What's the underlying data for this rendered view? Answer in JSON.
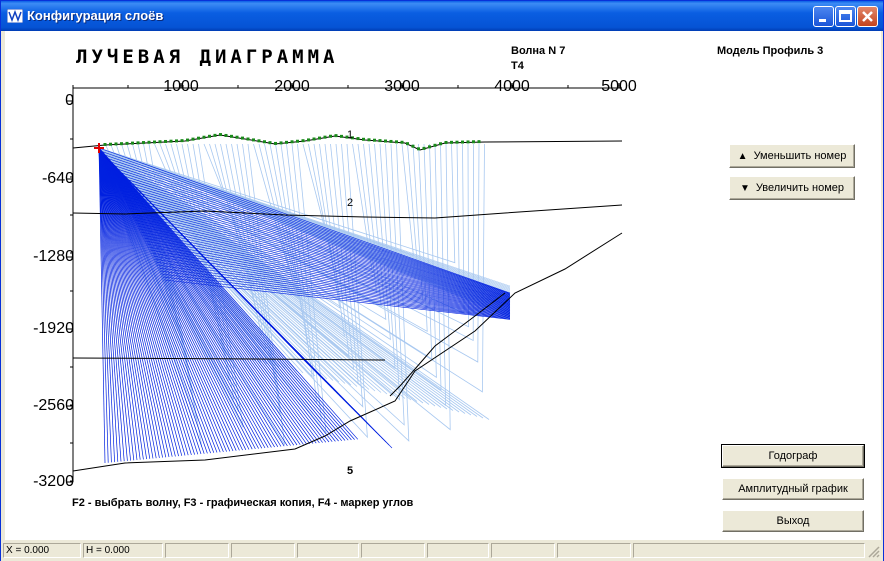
{
  "window": {
    "title": "Конфигурация слоёв",
    "colors": {
      "titlebar": "#0a5ee2",
      "bg": "#ece9d8"
    }
  },
  "plot": {
    "title": "ЛУЧЕВАЯ ДИАГРАММА",
    "wave_label": "Волна N 7",
    "wave_type": "T4",
    "model_label": "Модель Профиль 3",
    "x_ticks": [
      "1000",
      "2000",
      "3000",
      "4000",
      "5000"
    ],
    "y_ticks": [
      "0",
      "-640",
      "-1280",
      "-1920",
      "-2560",
      "-3200"
    ],
    "layer_labels": [
      "1",
      "2",
      "5"
    ],
    "hint": "F2 - выбрать волну, F3 - графическая копия, F4 - маркер углов",
    "colors": {
      "rays_dark": "#0020e0",
      "rays_light": "#a8c8f0",
      "receivers": "#1a8a1a",
      "source": "#e00000"
    }
  },
  "buttons": {
    "decrease": "Уменьшить номер",
    "increase": "Увеличить номер",
    "traveltime": "Годограф",
    "amplitude": "Амплитудный график",
    "exit": "Выход"
  },
  "status": {
    "x": "X = 0.000",
    "h": "H = 0.000"
  }
}
